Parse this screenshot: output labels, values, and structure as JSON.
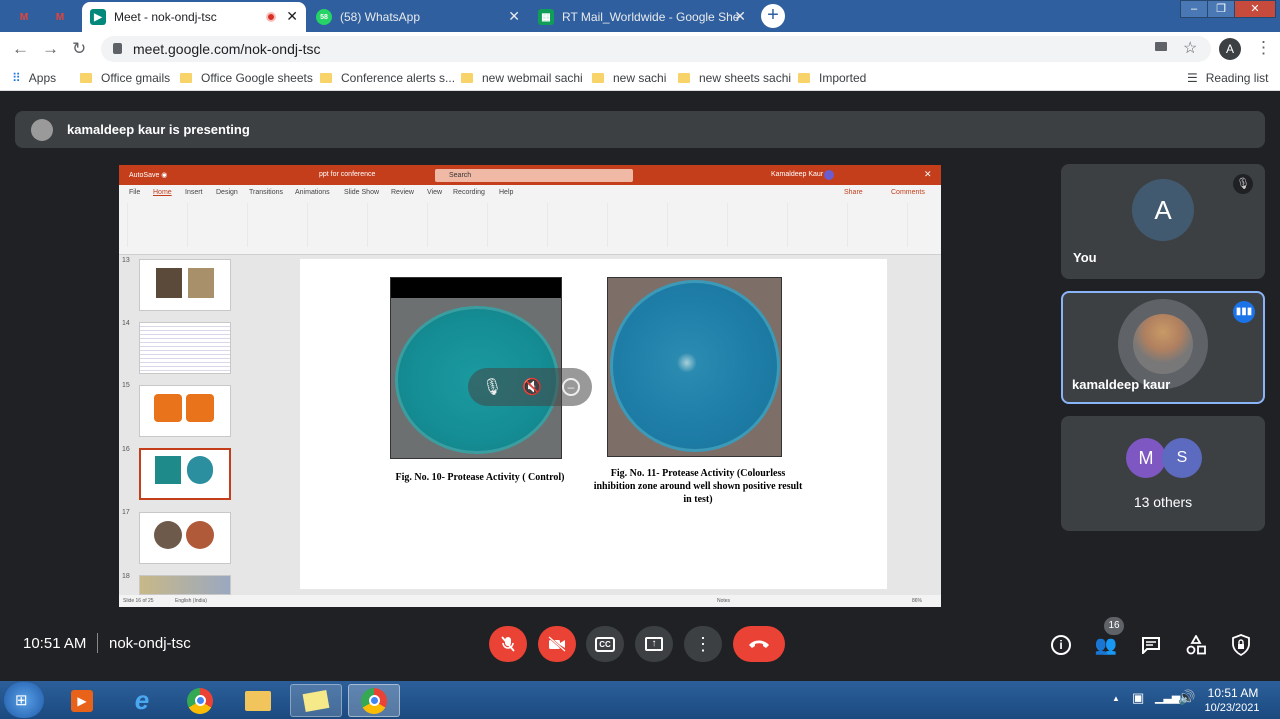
{
  "browser": {
    "tabs": [
      {
        "label": "",
        "icon": "gmail-icon"
      },
      {
        "label": "",
        "icon": "gmail-icon"
      },
      {
        "label": "Meet - nok-ondj-tsc",
        "icon": "meet-icon",
        "active": true,
        "recording": true
      },
      {
        "label": "(58) WhatsApp",
        "icon": "whatsapp-icon"
      },
      {
        "label": "RT Mail_Worldwide - Google She",
        "icon": "sheets-icon"
      }
    ],
    "url": "meet.google.com/nok-ondj-tsc",
    "profile_initial": "A",
    "bookmarks": [
      "Apps",
      "Office gmails",
      "Office Google sheets",
      "Conference alerts s...",
      "new webmail sachi",
      "new sachi",
      "new sheets sachi",
      "Imported"
    ],
    "reading_list": "Reading list"
  },
  "meet": {
    "presenting_text": "kamaldeep kaur is presenting",
    "time": "10:51 AM",
    "meeting_code": "nok-ondj-tsc",
    "participant_count": "16",
    "participants": [
      {
        "name": "You",
        "initial": "A",
        "avatar_color": "#425a70",
        "muted": true
      },
      {
        "name": "kamaldeep kaur",
        "speaking": true
      },
      {
        "name": "13 others",
        "initials": [
          "M",
          "S"
        ],
        "colors": [
          "#7e57c2",
          "#5c6bc0"
        ]
      }
    ]
  },
  "slide": {
    "app_title": "ppt for conference",
    "search": "Search",
    "user": "Kamaldeep Kaur",
    "menu": [
      "File",
      "Home",
      "Insert",
      "Design",
      "Transitions",
      "Animations",
      "Slide Show",
      "Review",
      "View",
      "Recording",
      "Help"
    ],
    "share": "Share",
    "comments": "Comments",
    "thumb_numbers": [
      "13",
      "14",
      "15",
      "16",
      "17",
      "18"
    ],
    "caption_left": "Fig. No. 10- Protease Activity ( Control)",
    "caption_right": "Fig. No. 11- Protease Activity (Colourless inhibition zone around well shown positive result in test)",
    "status_left": "Slide 16 of 25",
    "status_lang": "English (India)",
    "status_notes": "Notes",
    "zoom": "86%"
  },
  "taskbar": {
    "clock_time": "10:51 AM",
    "clock_date": "10/23/2021"
  },
  "colors": {
    "meet_bg": "#202124",
    "hangup": "#ea4335",
    "accent": "#8ab4f8"
  }
}
